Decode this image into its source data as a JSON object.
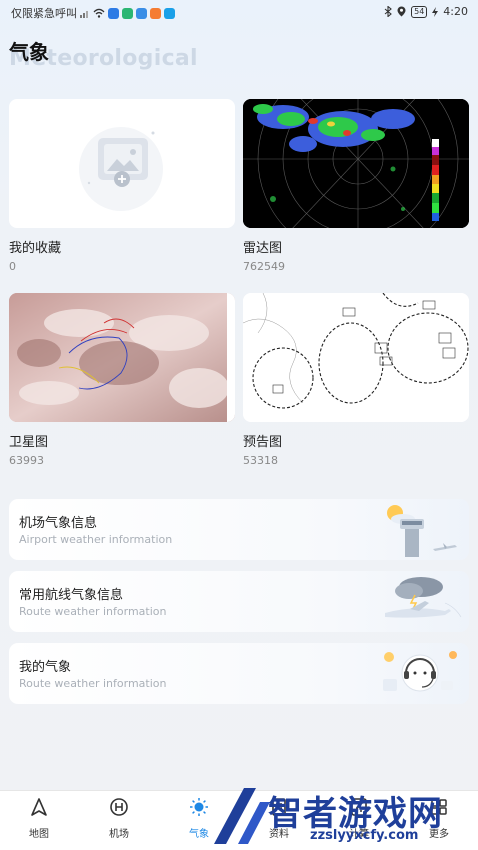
{
  "status": {
    "carrier": "仅限紧急呼叫",
    "battery": "54",
    "time": "4:20"
  },
  "header": {
    "title": "气象",
    "subtitle": "Meteorological"
  },
  "cards": [
    {
      "name": "我的收藏",
      "count": "0"
    },
    {
      "name": "雷达图",
      "count": "762549"
    },
    {
      "name": "卫星图",
      "count": "63993"
    },
    {
      "name": "预告图",
      "count": "53318"
    }
  ],
  "rows": [
    {
      "title": "机场气象信息",
      "subtitle": "Airport weather information"
    },
    {
      "title": "常用航线气象信息",
      "subtitle": "Route weather information"
    },
    {
      "title": "我的气象",
      "subtitle": "Route weather information"
    }
  ],
  "tabs": [
    {
      "label": "地图"
    },
    {
      "label": "机场"
    },
    {
      "label": "气象"
    },
    {
      "label": "资料"
    },
    {
      "label": "计算"
    },
    {
      "label": "更多"
    }
  ],
  "active_tab": "气象",
  "watermark": {
    "title": "智者游戏网",
    "url": "zzslyyxcfy.com"
  },
  "colors": {
    "accent": "#1e88e5",
    "watermark": "#1f3f9a"
  }
}
